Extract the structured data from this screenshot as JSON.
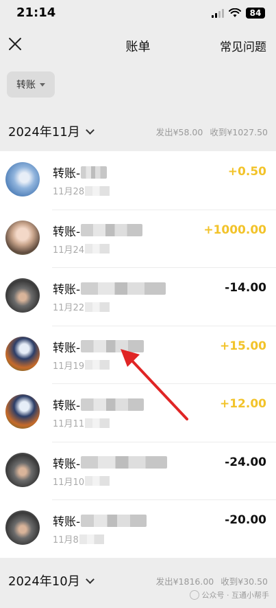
{
  "status_bar": {
    "time": "21:14",
    "battery": "84"
  },
  "nav": {
    "title": "账单",
    "faq_label": "常见问题"
  },
  "filter": {
    "label": "转账"
  },
  "months": [
    {
      "label": "2024年11月",
      "expense": "发出¥58.00",
      "income": "收到¥1027.50"
    },
    {
      "label": "2024年10月",
      "expense": "发出¥1816.00",
      "income": "收到¥30.50"
    }
  ],
  "transactions": [
    {
      "title": "转账-",
      "date": "11月28",
      "amount": "+0.50",
      "type": "in"
    },
    {
      "title": "转账-",
      "date": "11月24",
      "amount": "+1000.00",
      "type": "in"
    },
    {
      "title": "转账-",
      "date": "11月22",
      "amount": "-14.00",
      "type": "out"
    },
    {
      "title": "转账-",
      "date": "11月19",
      "amount": "+15.00",
      "type": "in"
    },
    {
      "title": "转账-",
      "date": "11月11",
      "amount": "+12.00",
      "type": "in"
    },
    {
      "title": "转账-",
      "date": "11月10",
      "amount": "-24.00",
      "type": "out"
    },
    {
      "title": "转账-",
      "date": "11月8",
      "amount": "-20.00",
      "type": "out"
    }
  ],
  "watermark": "公众号 · 互通小帮手",
  "colors": {
    "income": "#f2c32a",
    "expense": "#111111",
    "arrow": "#e02525"
  }
}
